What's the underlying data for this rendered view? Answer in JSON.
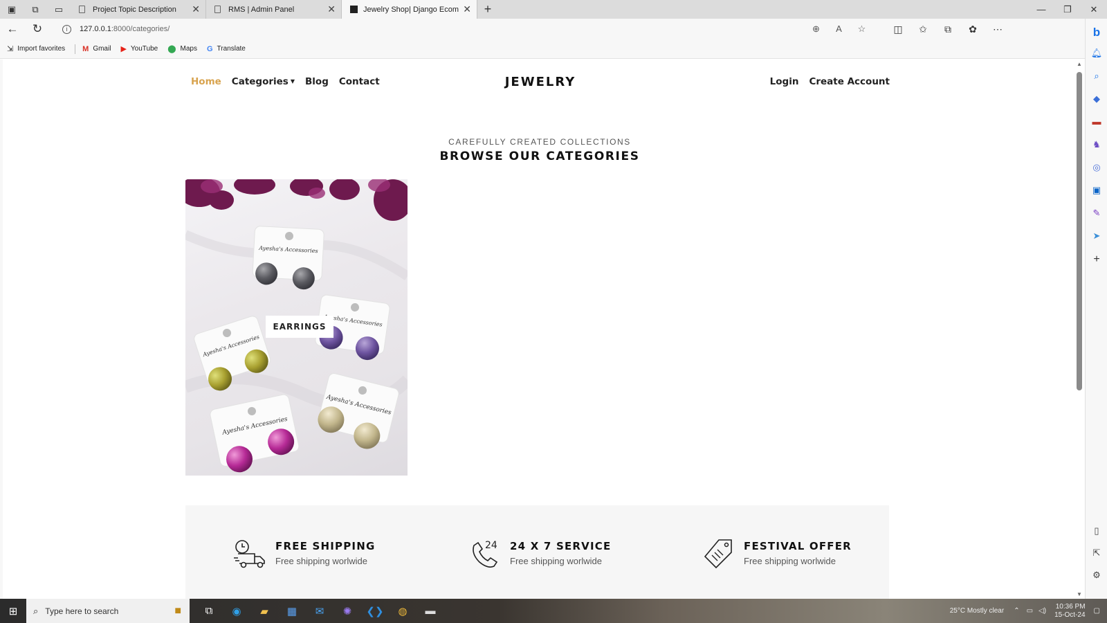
{
  "browser": {
    "tabs": [
      {
        "title": "Project Topic Description",
        "active": false,
        "icon": "document-icon"
      },
      {
        "title": "RMS | Admin Panel",
        "active": false,
        "icon": "document-icon"
      },
      {
        "title": "Jewelry Shop| Django Ecommerce",
        "active": true,
        "icon": "django-icon"
      }
    ],
    "url_host": "127.0.0.1",
    "url_path": ":8000/categories/",
    "bookmarks": [
      {
        "label": "Import favorites",
        "icon": "import-icon"
      },
      {
        "label": "Gmail",
        "icon": "gmail-icon"
      },
      {
        "label": "YouTube",
        "icon": "youtube-icon"
      },
      {
        "label": "Maps",
        "icon": "maps-icon"
      },
      {
        "label": "Translate",
        "icon": "translate-icon"
      }
    ]
  },
  "site": {
    "nav": {
      "home": "Home",
      "categories": "Categories",
      "blog": "Blog",
      "contact": "Contact",
      "brand": "JEWELRY",
      "login": "Login",
      "create_account": "Create Account"
    },
    "eyebrow": "CAREFULLY CREATED COLLECTIONS",
    "heading": "BROWSE OUR CATEGORIES",
    "categories": [
      {
        "label": "EARRINGS",
        "card_text": "Ayesha's Accessories"
      }
    ],
    "features": [
      {
        "title": "FREE SHIPPING",
        "subtitle": "Free shipping worlwide",
        "icon": "delivery-truck-icon"
      },
      {
        "title": "24 X 7 SERVICE",
        "subtitle": "Free shipping worlwide",
        "icon": "phone-24-icon"
      },
      {
        "title": "FESTIVAL OFFER",
        "subtitle": "Free shipping worlwide",
        "icon": "price-tag-icon"
      }
    ],
    "colors": {
      "accent": "#d8a34e",
      "text": "#111111",
      "feature_bg": "#f6f6f6"
    }
  },
  "taskbar": {
    "search_placeholder": "Type here to search",
    "weather": "25°C  Mostly clear",
    "time": "10:36 PM",
    "date": "15-Oct-24"
  }
}
